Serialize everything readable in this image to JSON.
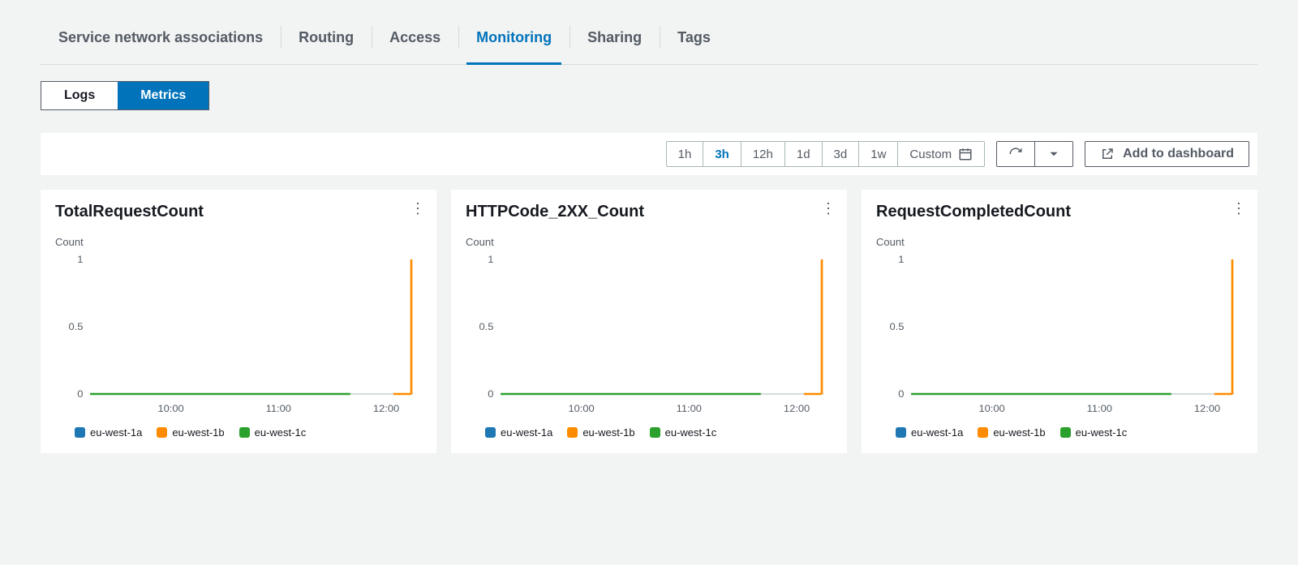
{
  "tabs": {
    "items": [
      {
        "label": "Service network associations",
        "active": false
      },
      {
        "label": "Routing",
        "active": false
      },
      {
        "label": "Access",
        "active": false
      },
      {
        "label": "Monitoring",
        "active": true
      },
      {
        "label": "Sharing",
        "active": false
      },
      {
        "label": "Tags",
        "active": false
      }
    ]
  },
  "subtabs": {
    "items": [
      {
        "label": "Logs",
        "active": false
      },
      {
        "label": "Metrics",
        "active": true
      }
    ]
  },
  "toolbar": {
    "ranges": [
      {
        "label": "1h",
        "active": false
      },
      {
        "label": "3h",
        "active": true
      },
      {
        "label": "12h",
        "active": false
      },
      {
        "label": "1d",
        "active": false
      },
      {
        "label": "3d",
        "active": false
      },
      {
        "label": "1w",
        "active": false
      }
    ],
    "custom_label": "Custom",
    "add_label": "Add to dashboard"
  },
  "legend_series": [
    {
      "name": "eu-west-1a",
      "color": "#1f77b4"
    },
    {
      "name": "eu-west-1b",
      "color": "#ff8c00"
    },
    {
      "name": "eu-west-1c",
      "color": "#2ca02c"
    }
  ],
  "cards": [
    {
      "title": "TotalRequestCount",
      "ylabel": "Count"
    },
    {
      "title": "HTTPCode_2XX_Count",
      "ylabel": "Count"
    },
    {
      "title": "RequestCompletedCount",
      "ylabel": "Count"
    }
  ],
  "chart_data": [
    {
      "type": "line",
      "title": "TotalRequestCount",
      "ylabel": "Count",
      "ylim": [
        0,
        1
      ],
      "y_ticks": [
        0,
        0.5,
        1
      ],
      "x_ticks": [
        "10:00",
        "11:00",
        "12:00"
      ],
      "x_range_hours": [
        "09:15",
        "12:15"
      ],
      "series": [
        {
          "name": "eu-west-1a",
          "color": "#1f77b4",
          "values_note": "flat at 0 across range"
        },
        {
          "name": "eu-west-1b",
          "color": "#ff8c00",
          "values_note": "0 until ~12:10, spikes to 1 at ~12:14"
        },
        {
          "name": "eu-west-1c",
          "color": "#2ca02c",
          "values_note": "flat at 0 until ~11:40"
        }
      ]
    },
    {
      "type": "line",
      "title": "HTTPCode_2XX_Count",
      "ylabel": "Count",
      "ylim": [
        0,
        1
      ],
      "y_ticks": [
        0,
        0.5,
        1
      ],
      "x_ticks": [
        "10:00",
        "11:00",
        "12:00"
      ],
      "x_range_hours": [
        "09:15",
        "12:15"
      ],
      "series": [
        {
          "name": "eu-west-1a",
          "color": "#1f77b4",
          "values_note": "flat at 0 across range"
        },
        {
          "name": "eu-west-1b",
          "color": "#ff8c00",
          "values_note": "0 until ~12:10, spikes to 1 at ~12:14"
        },
        {
          "name": "eu-west-1c",
          "color": "#2ca02c",
          "values_note": "flat at 0 until ~11:40"
        }
      ]
    },
    {
      "type": "line",
      "title": "RequestCompletedCount",
      "ylabel": "Count",
      "ylim": [
        0,
        1
      ],
      "y_ticks": [
        0,
        0.5,
        1
      ],
      "x_ticks": [
        "10:00",
        "11:00",
        "12:00"
      ],
      "x_range_hours": [
        "09:15",
        "12:15"
      ],
      "series": [
        {
          "name": "eu-west-1a",
          "color": "#1f77b4",
          "values_note": "flat at 0 across range"
        },
        {
          "name": "eu-west-1b",
          "color": "#ff8c00",
          "values_note": "0 until ~12:10, spikes to 1 at ~12:14"
        },
        {
          "name": "eu-west-1c",
          "color": "#2ca02c",
          "values_note": "flat at 0 until ~11:40"
        }
      ]
    }
  ]
}
